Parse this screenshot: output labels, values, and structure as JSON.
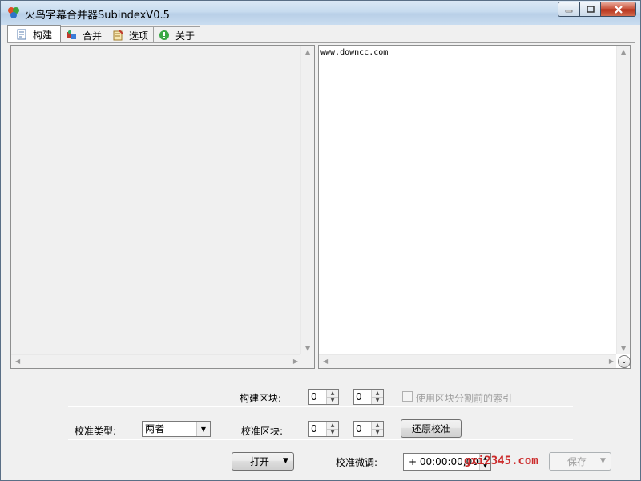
{
  "window": {
    "title": "火鸟字幕合并器SubindexV0.5"
  },
  "tabs": [
    {
      "label": "构建",
      "icon": "build-icon"
    },
    {
      "label": "合并",
      "icon": "merge-icon"
    },
    {
      "label": "选项",
      "icon": "options-icon"
    },
    {
      "label": "关于",
      "icon": "info-icon"
    }
  ],
  "right_pane": {
    "text": "www.downcc.com"
  },
  "build_block": {
    "label": "构建区块:",
    "start": "0",
    "end": "0",
    "checkbox_label": "使用区块分割前的索引"
  },
  "calibration": {
    "type_label": "校准类型:",
    "type_value": "两者",
    "block_label": "校准区块:",
    "block_start": "0",
    "block_end": "0",
    "restore_button": "还原校准",
    "fine_tune_label": "校准微调:",
    "fine_tune_value": "+ 00:00:00,000"
  },
  "footer": {
    "open_button": "打开",
    "save_button": "保存",
    "watermark": "gxi2345.com"
  },
  "colors": {
    "titlebar": "#c7dbef",
    "close_button": "#c74d35",
    "watermark": "#cc2b2b"
  }
}
